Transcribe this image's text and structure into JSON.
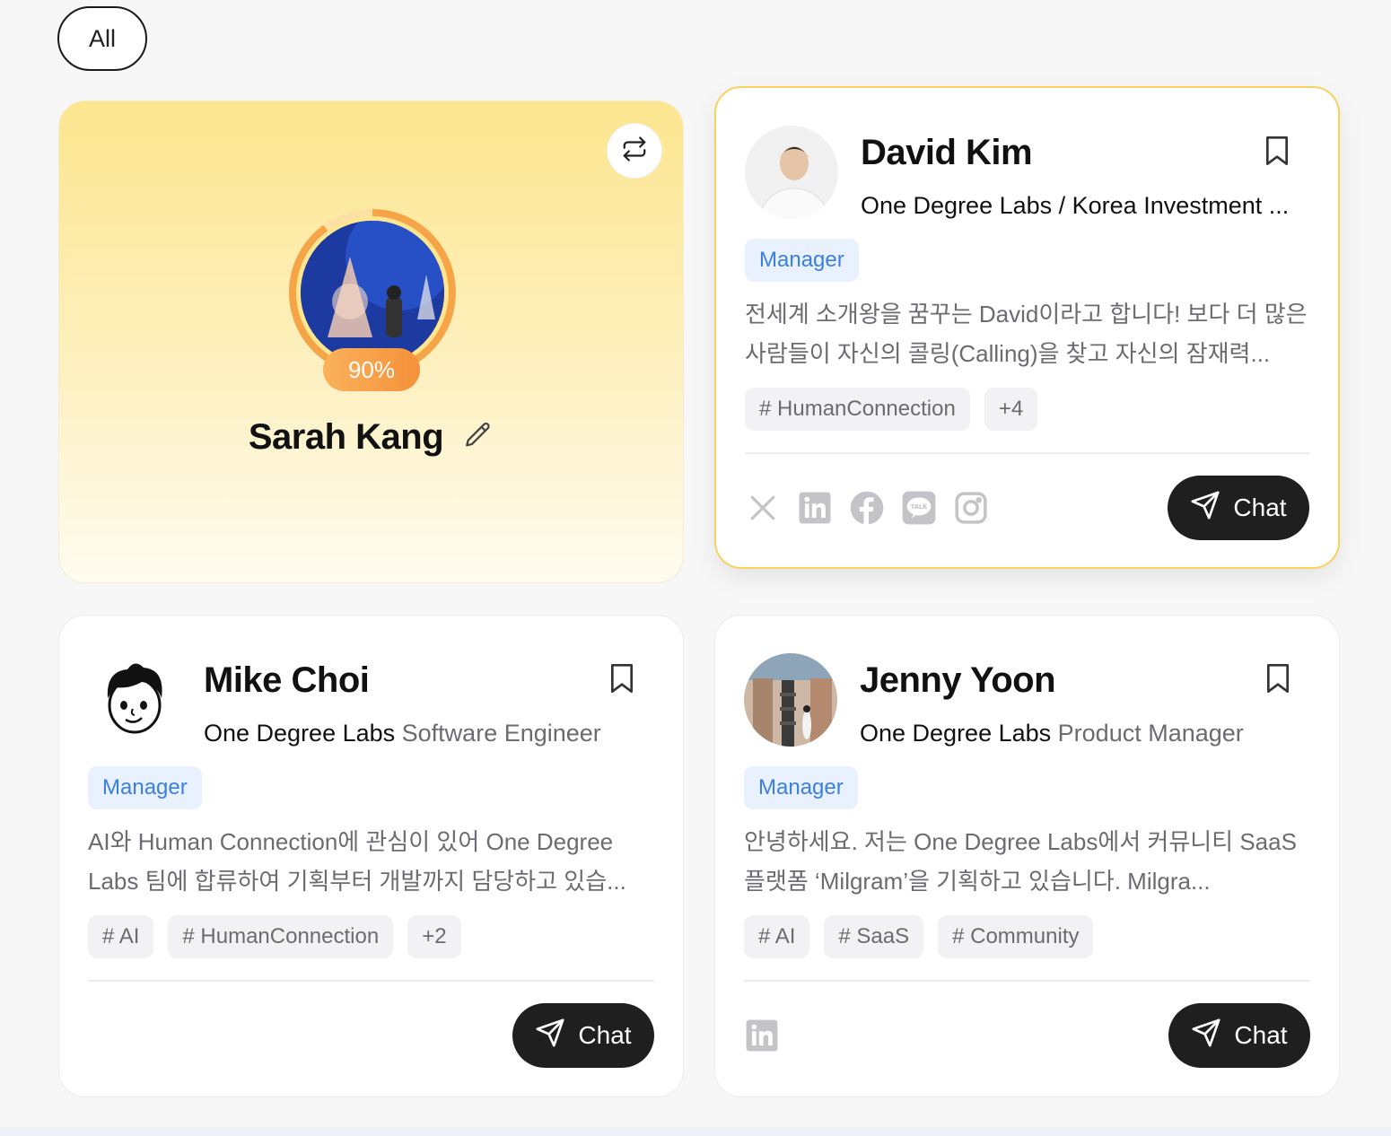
{
  "filter": {
    "label": "All"
  },
  "my_card": {
    "name": "Sarah Kang",
    "completion_label": "90%",
    "completion": 0.9,
    "accent": "#f5a548"
  },
  "profiles": [
    {
      "name": "David Kim",
      "org": "One Degree Labs / Korea Investment ...",
      "role": "",
      "tag": "Manager",
      "bio": "전세계 소개왕을 꿈꾸는 David이라고 합니다! 보다 더 많은 사람들이 자신의 콜링(Calling)을 찾고 자신의 잠재력...",
      "tags": [
        "# HumanConnection",
        "+4"
      ],
      "socials": [
        "x-icon",
        "linkedin-icon",
        "facebook-icon",
        "kakaotalk-icon",
        "instagram-icon"
      ],
      "chat_label": "Chat"
    },
    {
      "name": "Mike Choi",
      "org": "One Degree Labs",
      "role": "Software Engineer",
      "tag": "Manager",
      "bio": "AI와 Human Connection에 관심이 있어 One Degree Labs 팀에 합류하여 기획부터 개발까지 담당하고 있습...",
      "tags": [
        "# AI",
        "# HumanConnection",
        "+2"
      ],
      "socials": [],
      "chat_label": "Chat"
    },
    {
      "name": "Jenny Yoon",
      "org": "One Degree Labs",
      "role": "Product Manager",
      "tag": "Manager",
      "bio": "안녕하세요. 저는 One Degree Labs에서 커뮤니티 SaaS 플랫폼 ‘Milgram’을 기획하고 있습니다. Milgra...",
      "tags": [
        "# AI",
        "# SaaS",
        "# Community"
      ],
      "socials": [
        "linkedin-icon"
      ],
      "chat_label": "Chat"
    }
  ]
}
